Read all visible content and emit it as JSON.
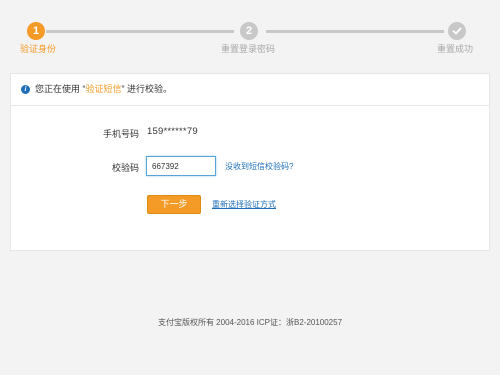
{
  "stepper": {
    "steps": [
      {
        "number": "1",
        "label": "验证身份",
        "state": "active"
      },
      {
        "number": "2",
        "label": "重置登录密码",
        "state": "pending"
      },
      {
        "icon": "checkmark-icon",
        "label": "重置成功",
        "state": "pending"
      }
    ],
    "colors": {
      "active": "#f39b26",
      "inactive": "#c8c8c8"
    }
  },
  "notice": {
    "icon": "info-icon",
    "prefix": "您正在使用 “",
    "method": "验证短信",
    "suffix": "” 进行校验。"
  },
  "form": {
    "phone_label": "手机号码",
    "phone_value": "159******79",
    "code_label": "校验码",
    "code_value": "667392",
    "no_code_link": "没收到短信校验码?",
    "next_button": "下一步",
    "alt_method_link": "重新选择验证方式"
  },
  "footer": {
    "text": "支付宝版权所有 2004-2016 ICP证：浙B2-20100257"
  },
  "colors": {
    "accent": "#f39b26",
    "link": "#1e6fb8",
    "input_border": "#58a6d8"
  }
}
